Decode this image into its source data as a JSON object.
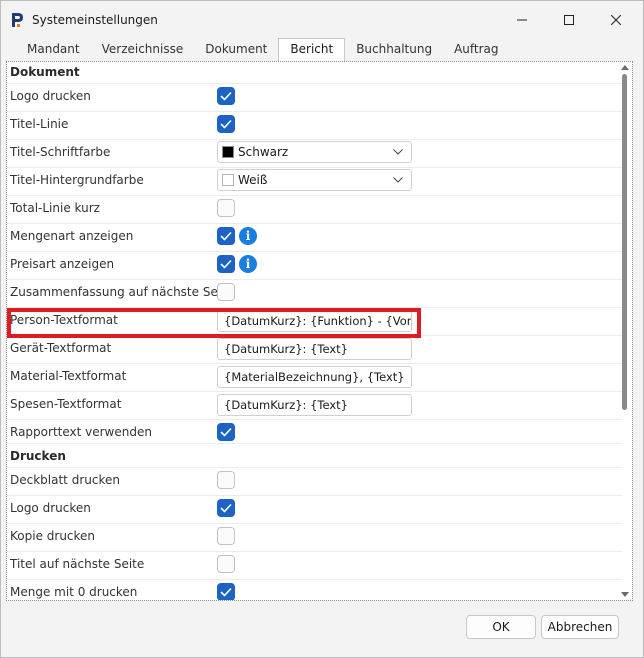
{
  "window": {
    "title": "Systemeinstellungen"
  },
  "tabs": [
    {
      "label": "Mandant"
    },
    {
      "label": "Verzeichnisse"
    },
    {
      "label": "Dokument"
    },
    {
      "label": "Bericht",
      "active": true
    },
    {
      "label": "Buchhaltung"
    },
    {
      "label": "Auftrag"
    }
  ],
  "sections": {
    "dokument": "Dokument",
    "drucken": "Drucken"
  },
  "rows": [
    {
      "label": "Logo drucken",
      "type": "checkbox",
      "checked": true
    },
    {
      "label": "Titel-Linie",
      "type": "checkbox",
      "checked": true
    },
    {
      "label": "Titel-Schriftfarbe",
      "type": "combo",
      "value": "Schwarz",
      "swatch": "#000000"
    },
    {
      "label": "Titel-Hintergrundfarbe",
      "type": "combo",
      "value": "Weiß",
      "swatch": "#ffffff"
    },
    {
      "label": "Total-Linie kurz",
      "type": "checkbox",
      "checked": false
    },
    {
      "label": "Mengenart anzeigen",
      "type": "checkbox",
      "checked": true,
      "info": "i"
    },
    {
      "label": "Preisart anzeigen",
      "type": "checkbox",
      "checked": true,
      "info": "i"
    },
    {
      "label": "Zusammenfassung auf nächste Seite",
      "type": "checkbox",
      "checked": false
    },
    {
      "label": "Person-Textformat",
      "type": "text",
      "value": "{DatumKurz}: {Funktion} - {Vornam"
    },
    {
      "label": "Gerät-Textformat",
      "type": "text",
      "value": "{DatumKurz}: {Text}"
    },
    {
      "label": "Material-Textformat",
      "type": "text",
      "value": "{MaterialBezeichnung}, {Text}"
    },
    {
      "label": "Spesen-Textformat",
      "type": "text",
      "value": "{DatumKurz}: {Text}"
    },
    {
      "label": "Rapporttext verwenden",
      "type": "checkbox",
      "checked": true
    }
  ],
  "print_rows": [
    {
      "label": "Deckblatt drucken",
      "checked": false
    },
    {
      "label": "Logo drucken",
      "checked": true
    },
    {
      "label": "Kopie drucken",
      "checked": false
    },
    {
      "label": "Titel auf nächste Seite",
      "checked": false
    },
    {
      "label": "Menge mit 0 drucken",
      "checked": true
    }
  ],
  "buttons": {
    "ok": "OK",
    "cancel": "Abbrechen"
  },
  "colors": {
    "accent": "#1d63c4",
    "highlight": "#e01b22",
    "info": "#1a7fdc"
  }
}
